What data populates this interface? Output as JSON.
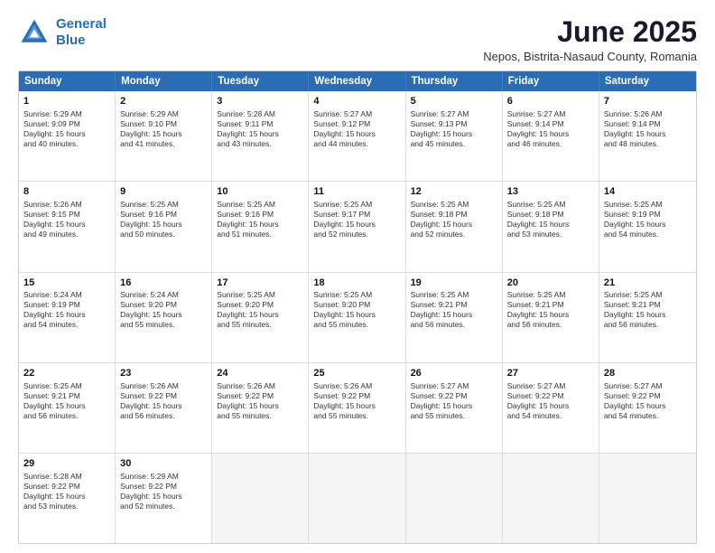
{
  "logo": {
    "line1": "General",
    "line2": "Blue"
  },
  "title": "June 2025",
  "subtitle": "Nepos, Bistrita-Nasaud County, Romania",
  "header_days": [
    "Sunday",
    "Monday",
    "Tuesday",
    "Wednesday",
    "Thursday",
    "Friday",
    "Saturday"
  ],
  "weeks": [
    [
      {
        "day": "1",
        "info": "Sunrise: 5:29 AM\nSunset: 9:09 PM\nDaylight: 15 hours\nand 40 minutes."
      },
      {
        "day": "2",
        "info": "Sunrise: 5:29 AM\nSunset: 9:10 PM\nDaylight: 15 hours\nand 41 minutes."
      },
      {
        "day": "3",
        "info": "Sunrise: 5:28 AM\nSunset: 9:11 PM\nDaylight: 15 hours\nand 43 minutes."
      },
      {
        "day": "4",
        "info": "Sunrise: 5:27 AM\nSunset: 9:12 PM\nDaylight: 15 hours\nand 44 minutes."
      },
      {
        "day": "5",
        "info": "Sunrise: 5:27 AM\nSunset: 9:13 PM\nDaylight: 15 hours\nand 45 minutes."
      },
      {
        "day": "6",
        "info": "Sunrise: 5:27 AM\nSunset: 9:14 PM\nDaylight: 15 hours\nand 46 minutes."
      },
      {
        "day": "7",
        "info": "Sunrise: 5:26 AM\nSunset: 9:14 PM\nDaylight: 15 hours\nand 48 minutes."
      }
    ],
    [
      {
        "day": "8",
        "info": "Sunrise: 5:26 AM\nSunset: 9:15 PM\nDaylight: 15 hours\nand 49 minutes."
      },
      {
        "day": "9",
        "info": "Sunrise: 5:25 AM\nSunset: 9:16 PM\nDaylight: 15 hours\nand 50 minutes."
      },
      {
        "day": "10",
        "info": "Sunrise: 5:25 AM\nSunset: 9:16 PM\nDaylight: 15 hours\nand 51 minutes."
      },
      {
        "day": "11",
        "info": "Sunrise: 5:25 AM\nSunset: 9:17 PM\nDaylight: 15 hours\nand 52 minutes."
      },
      {
        "day": "12",
        "info": "Sunrise: 5:25 AM\nSunset: 9:18 PM\nDaylight: 15 hours\nand 52 minutes."
      },
      {
        "day": "13",
        "info": "Sunrise: 5:25 AM\nSunset: 9:18 PM\nDaylight: 15 hours\nand 53 minutes."
      },
      {
        "day": "14",
        "info": "Sunrise: 5:25 AM\nSunset: 9:19 PM\nDaylight: 15 hours\nand 54 minutes."
      }
    ],
    [
      {
        "day": "15",
        "info": "Sunrise: 5:24 AM\nSunset: 9:19 PM\nDaylight: 15 hours\nand 54 minutes."
      },
      {
        "day": "16",
        "info": "Sunrise: 5:24 AM\nSunset: 9:20 PM\nDaylight: 15 hours\nand 55 minutes."
      },
      {
        "day": "17",
        "info": "Sunrise: 5:25 AM\nSunset: 9:20 PM\nDaylight: 15 hours\nand 55 minutes."
      },
      {
        "day": "18",
        "info": "Sunrise: 5:25 AM\nSunset: 9:20 PM\nDaylight: 15 hours\nand 55 minutes."
      },
      {
        "day": "19",
        "info": "Sunrise: 5:25 AM\nSunset: 9:21 PM\nDaylight: 15 hours\nand 56 minutes."
      },
      {
        "day": "20",
        "info": "Sunrise: 5:25 AM\nSunset: 9:21 PM\nDaylight: 15 hours\nand 56 minutes."
      },
      {
        "day": "21",
        "info": "Sunrise: 5:25 AM\nSunset: 9:21 PM\nDaylight: 15 hours\nand 56 minutes."
      }
    ],
    [
      {
        "day": "22",
        "info": "Sunrise: 5:25 AM\nSunset: 9:21 PM\nDaylight: 15 hours\nand 56 minutes."
      },
      {
        "day": "23",
        "info": "Sunrise: 5:26 AM\nSunset: 9:22 PM\nDaylight: 15 hours\nand 56 minutes."
      },
      {
        "day": "24",
        "info": "Sunrise: 5:26 AM\nSunset: 9:22 PM\nDaylight: 15 hours\nand 55 minutes."
      },
      {
        "day": "25",
        "info": "Sunrise: 5:26 AM\nSunset: 9:22 PM\nDaylight: 15 hours\nand 55 minutes."
      },
      {
        "day": "26",
        "info": "Sunrise: 5:27 AM\nSunset: 9:22 PM\nDaylight: 15 hours\nand 55 minutes."
      },
      {
        "day": "27",
        "info": "Sunrise: 5:27 AM\nSunset: 9:22 PM\nDaylight: 15 hours\nand 54 minutes."
      },
      {
        "day": "28",
        "info": "Sunrise: 5:27 AM\nSunset: 9:22 PM\nDaylight: 15 hours\nand 54 minutes."
      }
    ],
    [
      {
        "day": "29",
        "info": "Sunrise: 5:28 AM\nSunset: 9:22 PM\nDaylight: 15 hours\nand 53 minutes."
      },
      {
        "day": "30",
        "info": "Sunrise: 5:29 AM\nSunset: 9:22 PM\nDaylight: 15 hours\nand 52 minutes."
      },
      {
        "day": "",
        "info": "",
        "empty": true
      },
      {
        "day": "",
        "info": "",
        "empty": true
      },
      {
        "day": "",
        "info": "",
        "empty": true
      },
      {
        "day": "",
        "info": "",
        "empty": true
      },
      {
        "day": "",
        "info": "",
        "empty": true
      }
    ]
  ]
}
